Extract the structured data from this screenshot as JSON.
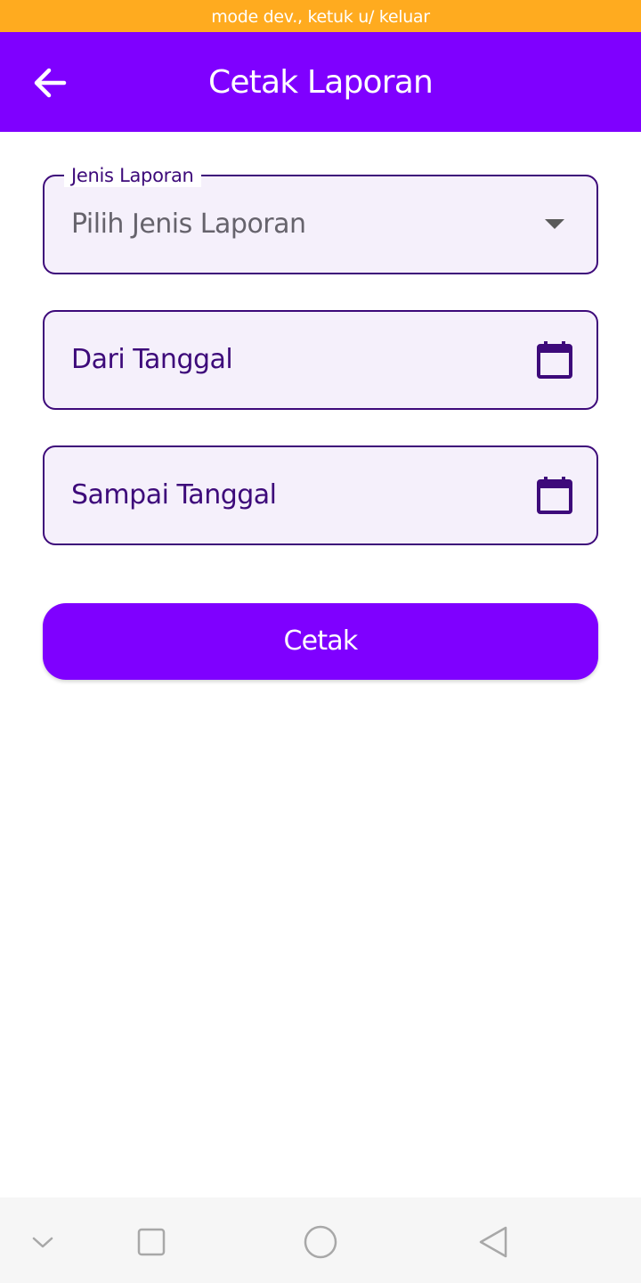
{
  "dev_banner": {
    "text": "mode dev., ketuk u/ keluar",
    "color": "#ffab1f"
  },
  "app_bar": {
    "title": "Cetak Laporan",
    "back_icon": "arrow-left-icon",
    "color": "#7f00ff"
  },
  "form": {
    "report_type": {
      "label": "Jenis Laporan",
      "placeholder": "Pilih Jenis Laporan",
      "icon": "dropdown-arrow-icon"
    },
    "start_date": {
      "label": "Dari Tanggal",
      "icon": "calendar-icon"
    },
    "end_date": {
      "label": "Sampai Tanggal",
      "icon": "calendar-icon"
    }
  },
  "print_button": {
    "label": "Cetak",
    "color": "#7f00ff"
  },
  "nav_bar": {
    "items": [
      "collapse-chevron-icon",
      "recents-square-icon",
      "home-circle-icon",
      "back-triangle-icon"
    ]
  }
}
